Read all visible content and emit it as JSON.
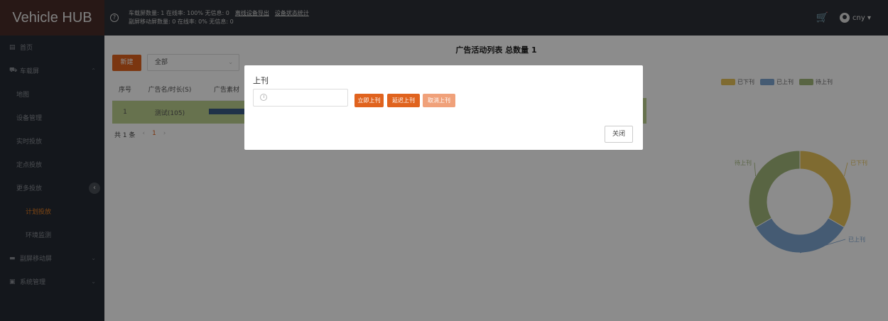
{
  "app": {
    "title": "Vehicle HUB",
    "help_icon": "?"
  },
  "header": {
    "stats_line1_a": "车载屏数量: 1 在线率: 100% 无信息: 0",
    "stats_link1": "离线设备导出",
    "stats_link2": "设备状态统计",
    "stats_line2": "副屏移动屏数量: 0 在线率: 0% 无信息: 0",
    "user_name": "cny ▾",
    "cart_icon": "cart-icon"
  },
  "sidebar": {
    "items": [
      {
        "label": "首页",
        "icon": "▤"
      },
      {
        "label": "车载屏",
        "icon": "⛟",
        "chevron": "⌃"
      },
      {
        "label": "地图"
      },
      {
        "label": "设备管理"
      },
      {
        "label": "实时投放"
      },
      {
        "label": "定点投放"
      },
      {
        "label": "更多投放",
        "chevron": "⌃"
      },
      {
        "label": "计划投放"
      },
      {
        "label": "环境监测"
      },
      {
        "label": "副屏移动屏",
        "icon": "▬",
        "chevron": "⌄"
      },
      {
        "label": "系统管理",
        "icon": "▣",
        "chevron": "⌄"
      }
    ],
    "collapse_label": "‹"
  },
  "main": {
    "title": "广告活动列表 总数量  1",
    "new_button": "新建",
    "filter_value": "全部",
    "filter_arrow": "⌄",
    "table": {
      "headers": [
        "序号",
        "广告名/时长(S)",
        "广告素材"
      ],
      "rows": [
        {
          "index": "1",
          "name": "测试(105)"
        }
      ]
    },
    "pager": {
      "total": "共 1 条",
      "prev": "‹",
      "page": "1",
      "next": "›"
    }
  },
  "chart_data": {
    "type": "pie",
    "legend_position": "top",
    "categories": [
      "已下刊",
      "已上刊",
      "待上刊"
    ],
    "values": [
      1,
      1,
      1
    ],
    "colors": [
      "#e7c45a",
      "#7ea6d2",
      "#a3b87a"
    ],
    "slice_labels": [
      "已下刊",
      "已上刊",
      "待上刊"
    ]
  },
  "modal": {
    "title": "上刊",
    "input_placeholder": "",
    "btn_now": "立即上刊",
    "btn_delay": "延迟上刊",
    "btn_cancel": "取消上刊",
    "btn_close": "关闭"
  }
}
